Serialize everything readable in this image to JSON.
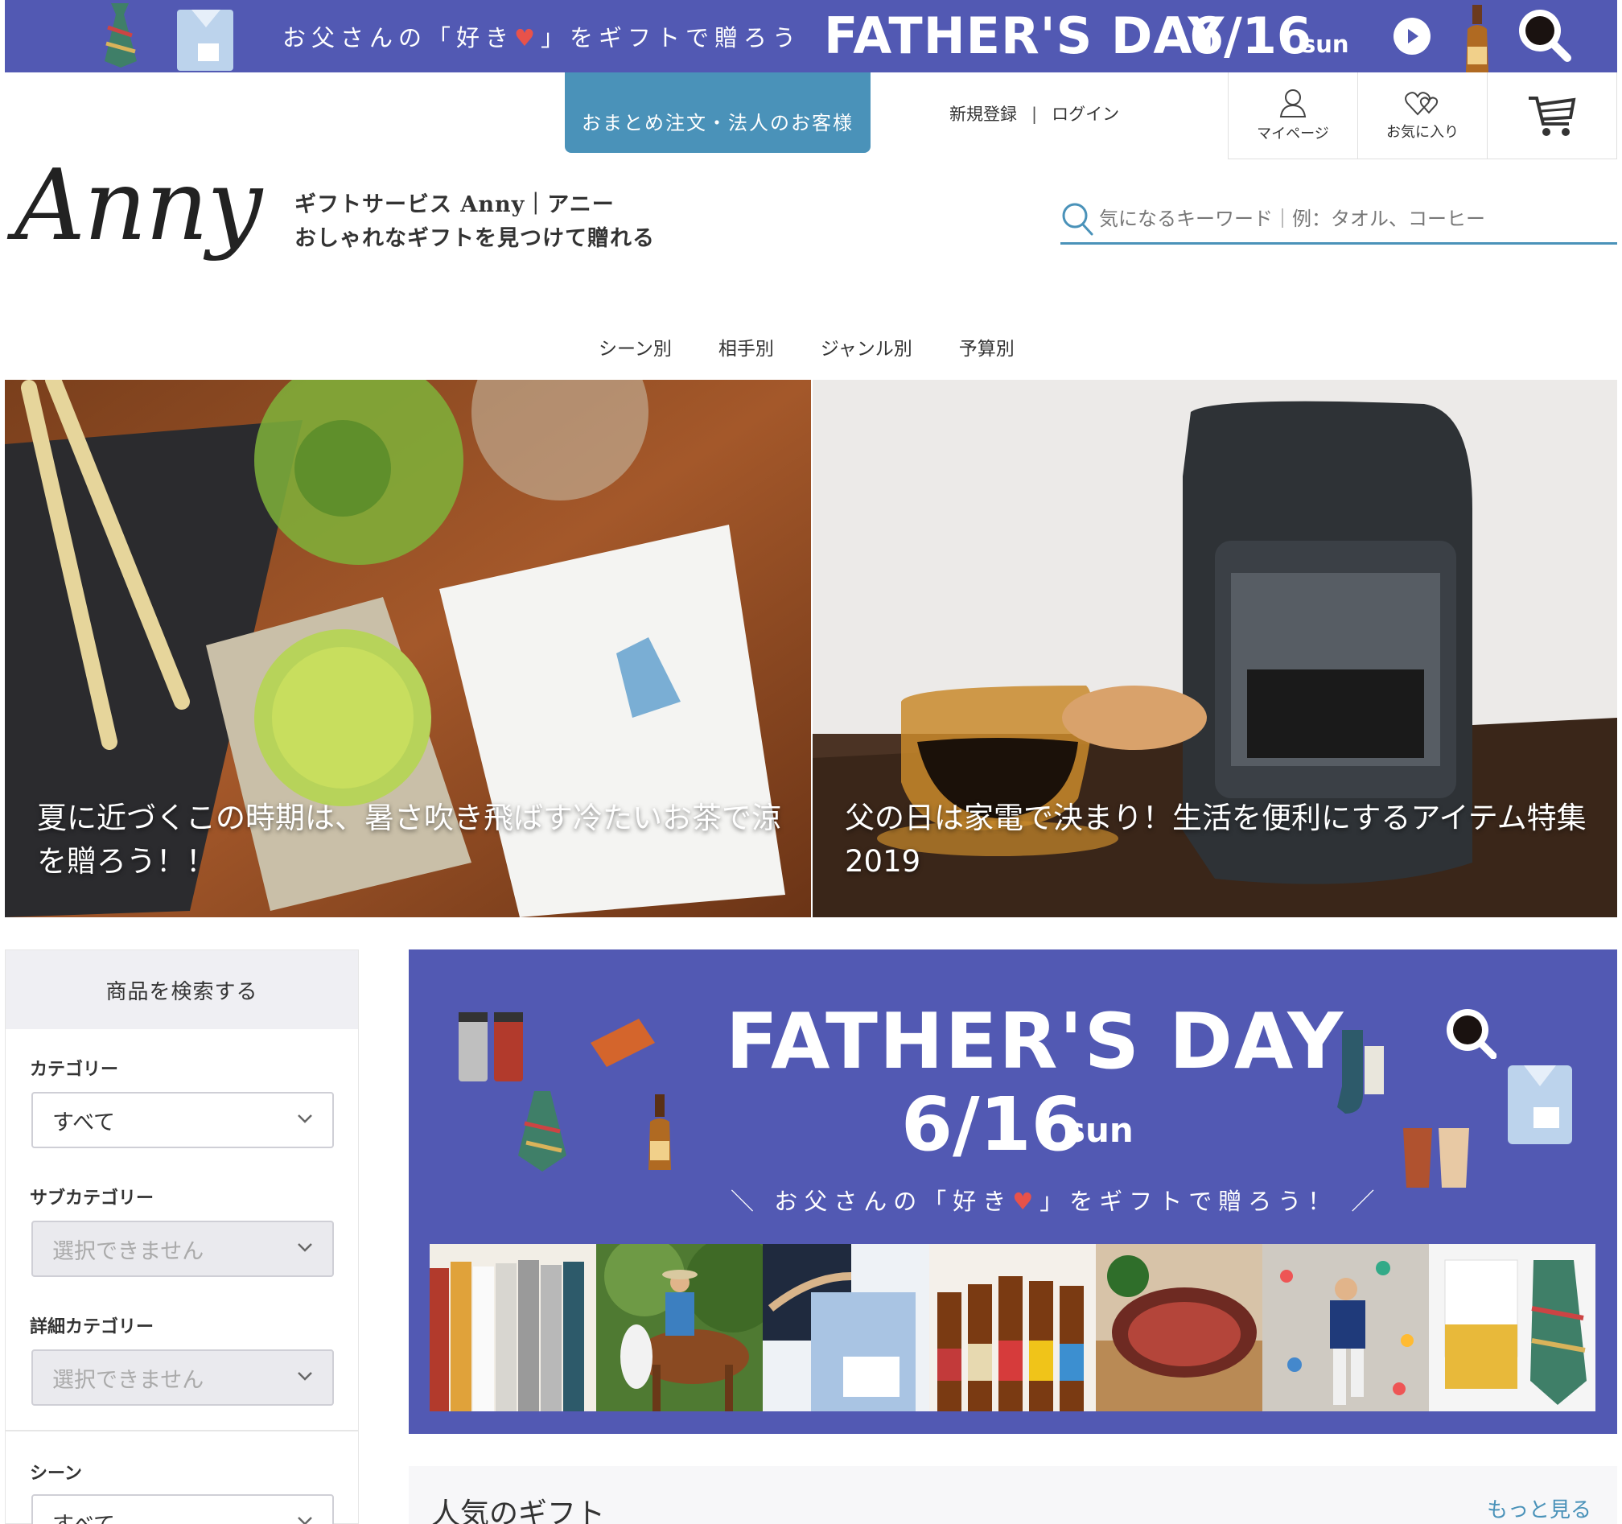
{
  "top_banner": {
    "tagline_before": "お父さんの「好き",
    "heart": "♥",
    "tagline_after": "」をギフトで贈ろう",
    "title": "FATHER'S DAY",
    "date": "6/16",
    "day": "sun",
    "icons": [
      "tie-icon",
      "shirt-icon",
      "play-icon",
      "beer-bottle-icon",
      "coffee-cup-icon"
    ]
  },
  "header": {
    "bulk_order_label": "おまとめ注文・法人のお客様",
    "register_label": "新規登録",
    "separator": "|",
    "login_label": "ログイン",
    "mypage_label": "マイページ",
    "favorites_label": "お気に入り",
    "cart_icon": "cart-icon"
  },
  "brand": {
    "logo_text": "Anny",
    "tagline_line1": "ギフトサービス Anny｜アニー",
    "tagline_line2": "おしゃれなギフトを見つけて贈れる"
  },
  "search": {
    "placeholder": "気になるキーワード｜例：タオル、コーヒー",
    "value": ""
  },
  "nav": {
    "items": [
      "シーン別",
      "相手別",
      "ジャンル別",
      "予算別"
    ]
  },
  "hero": {
    "left_caption": "夏に近づくこの時期は、暑さ吹き飛ばす冷たいお茶で涼を贈ろう！！",
    "right_caption": "父の日は家電で決まり！生活を便利にするアイテム特集2019"
  },
  "sidebar": {
    "title": "商品を検索する",
    "category_label": "カテゴリー",
    "category_value": "すべて",
    "subcategory_label": "サブカテゴリー",
    "subcategory_value": "選択できません",
    "detail_label": "詳細カテゴリー",
    "detail_value": "選択できません",
    "scene_label": "シーン",
    "scene_value": "すべて"
  },
  "fathers_day_banner": {
    "title": "FATHER'S DAY",
    "date": "6/16",
    "day": "sun",
    "sub_before": "＼ お父さんの「好き",
    "heart": "♥",
    "sub_after": "」をギフトで贈ろう！ ／"
  },
  "popular": {
    "title": "人気のギフト",
    "more_label": "もっと見る"
  },
  "colors": {
    "banner_blue": "#5259b3",
    "accent_blue": "#4a92b9",
    "heart_red": "#e8524a"
  }
}
